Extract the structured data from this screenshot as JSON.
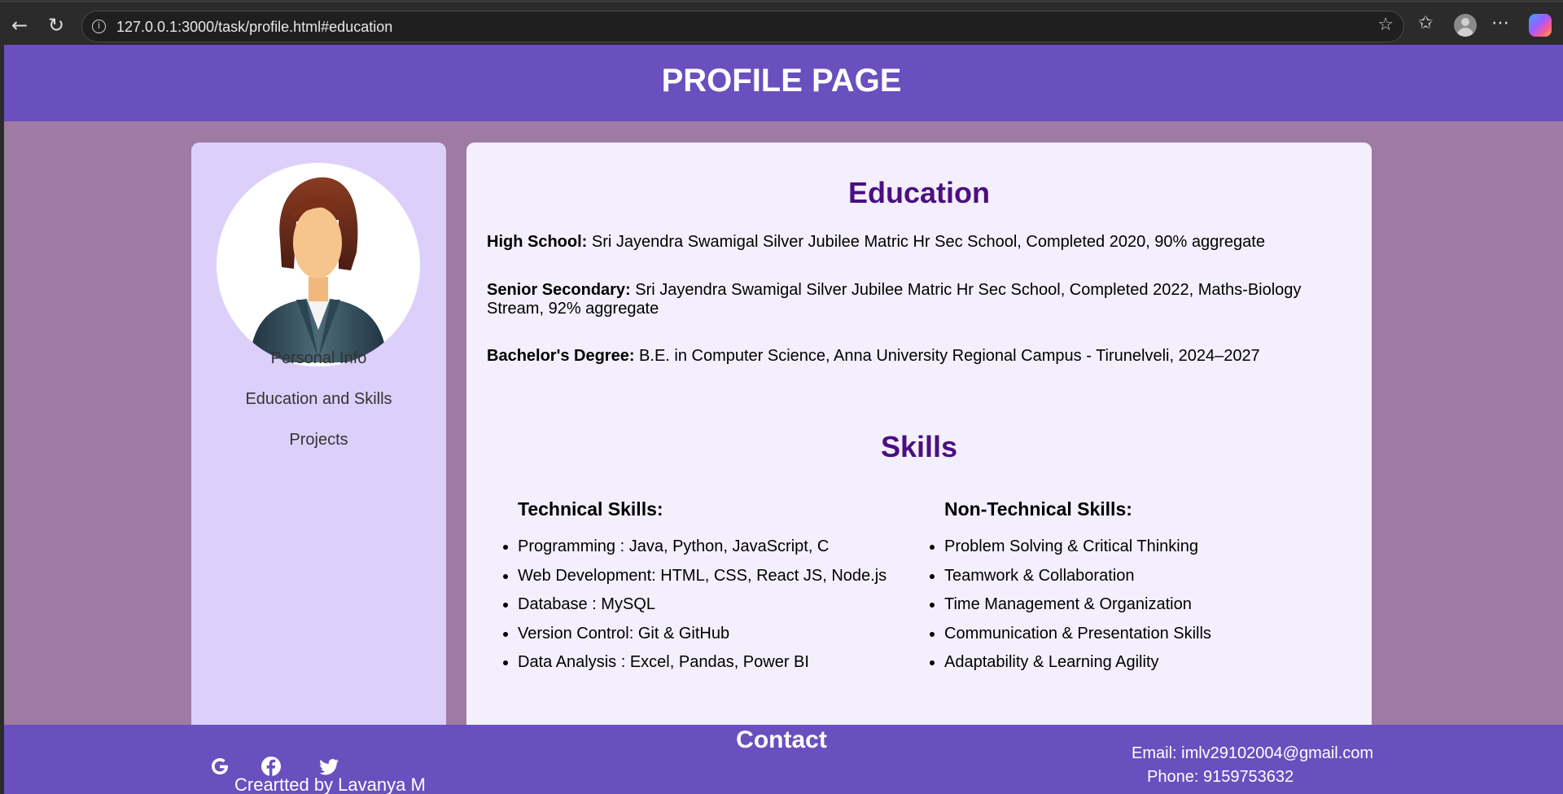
{
  "browser": {
    "url": "127.0.0.1:3000/task/profile.html#education"
  },
  "header": {
    "title": "PROFILE PAGE"
  },
  "sidebar": {
    "items": [
      {
        "label": "Personal Info"
      },
      {
        "label": "Education and Skills"
      },
      {
        "label": "Projects"
      }
    ]
  },
  "education": {
    "title": "Education",
    "entries": [
      {
        "label": "High School:",
        "text": " Sri Jayendra Swamigal Silver Jubilee Matric Hr Sec School, Completed 2020, 90% aggregate"
      },
      {
        "label": "Senior Secondary:",
        "text": " Sri Jayendra Swamigal Silver Jubilee Matric Hr Sec School, Completed 2022, Maths-Biology Stream, 92% aggregate"
      },
      {
        "label": "Bachelor's Degree:",
        "text": " B.E. in Computer Science, Anna University Regional Campus - Tirunelveli, 2024–2027"
      }
    ]
  },
  "skills": {
    "title": "Skills",
    "technical": {
      "heading": "Technical Skills:",
      "items": [
        "Programming : Java, Python, JavaScript, C",
        "Web Development: HTML, CSS, React JS, Node.js",
        "Database : MySQL",
        "Version Control: Git & GitHub",
        "Data Analysis : Excel, Pandas, Power BI"
      ]
    },
    "non_technical": {
      "heading": "Non-Technical Skills:",
      "items": [
        "Problem Solving & Critical Thinking",
        "Teamwork & Collaboration",
        "Time Management & Organization",
        "Communication & Presentation Skills",
        "Adaptability & Learning Agility"
      ]
    }
  },
  "footer": {
    "contact_title": "Contact",
    "credit": "Creartted by Lavanya M",
    "email": "Email: imlv29102004@gmail.com",
    "phone": "Phone: 9159753632",
    "icons": [
      "google-icon",
      "facebook-icon",
      "twitter-icon"
    ]
  },
  "colors": {
    "header": "#6a4fbf",
    "background": "#9e7ba3",
    "sidebar": "#dcd0fb",
    "card": "#f3effc",
    "heading": "#4b0f80"
  }
}
